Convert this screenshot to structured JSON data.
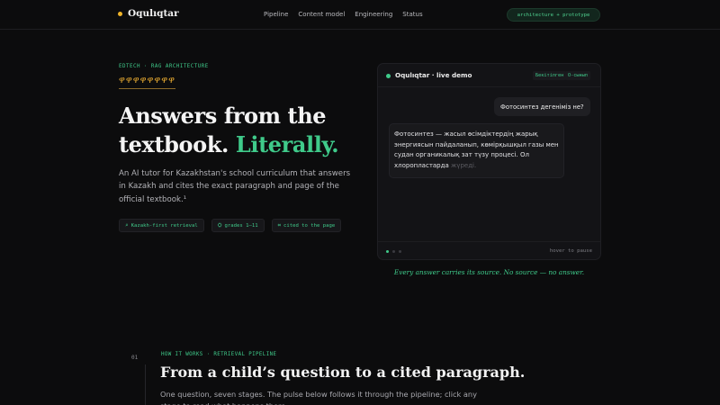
{
  "nav": {
    "brand": "Oqulıqtar",
    "links": [
      "Pipeline",
      "Content model",
      "Engineering",
      "Status"
    ],
    "pill": "architecture + prototype",
    "colors": {
      "brand_dot": "#f0b429",
      "accent": "#3fca8a"
    }
  },
  "hero": {
    "eyebrow": "EDTECH · RAG ARCHITECTURE",
    "ornament": "ዋዋዋዋዋዋዋዋ",
    "title_line1": "Answers from the",
    "title_line2": "textbook.",
    "title_accent": "Literally.",
    "description": "An AI tutor for Kazakhstan's school curriculum that answers in Kazakh and cites the exact paragraph and page of the official textbook.¹",
    "chips": [
      {
        "icon": "search-icon",
        "glyph": "⌕",
        "label": "Kazakh-first retrieval"
      },
      {
        "icon": "graduation-cap-icon",
        "glyph": "⛭",
        "label": "grades 1–11"
      },
      {
        "icon": "pin-icon",
        "glyph": "⌗",
        "label": "cited to the page"
      }
    ]
  },
  "demo": {
    "title": "Oqulıqtar · live demo",
    "tags": [
      "Бекітілген",
      "О-сынып"
    ],
    "question": "Фотосинтез дегеніміз не?",
    "answer": "Фотосинтез — жасыл өсімдіктердің жарық энергиясын пайдаланып, көмірқышқыл газы мен судан органикалық зат түзу процесі. Ол хлоропластарда",
    "answer_fade": "жүреді.",
    "hover_hint": "hover to pause",
    "progress_dots": [
      true,
      false,
      false
    ],
    "caption": "Every answer carries its source. No source — no answer."
  },
  "section": {
    "number": "01",
    "eyebrow": "HOW IT WORKS · RETRIEVAL PIPELINE",
    "title": "From a child’s question to a cited paragraph.",
    "description": "One question, seven stages. The pulse below follows it through the pipeline; click any stage to read what happens there."
  }
}
